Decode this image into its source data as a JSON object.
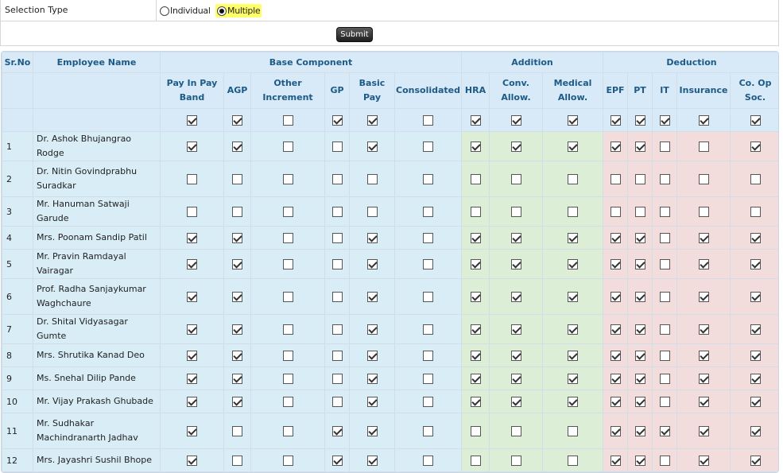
{
  "selection": {
    "label": "Selection Type",
    "options": [
      {
        "label": "Individual",
        "selected": false
      },
      {
        "label": "Multiple",
        "selected": true
      }
    ],
    "submit_label": "Submit"
  },
  "table": {
    "groups": {
      "srno": "Sr.No",
      "name": "Employee Name",
      "base": "Base Component",
      "addition": "Addition",
      "deduction": "Deduction"
    },
    "columns": [
      {
        "group": "base",
        "line1": "Pay In Pay",
        "line2": "Band"
      },
      {
        "group": "base",
        "line1": "AGP",
        "line2": ""
      },
      {
        "group": "base",
        "line1": "Other",
        "line2": "Increment"
      },
      {
        "group": "base",
        "line1": "GP",
        "line2": ""
      },
      {
        "group": "base",
        "line1": "Basic",
        "line2": "Pay"
      },
      {
        "group": "base",
        "line1": "Consolidated",
        "line2": ""
      },
      {
        "group": "addition",
        "line1": "HRA",
        "line2": ""
      },
      {
        "group": "addition",
        "line1": "Conv.",
        "line2": "Allow."
      },
      {
        "group": "addition",
        "line1": "Medical",
        "line2": "Allow."
      },
      {
        "group": "deduction",
        "line1": "EPF",
        "line2": ""
      },
      {
        "group": "deduction",
        "line1": "PT",
        "line2": ""
      },
      {
        "group": "deduction",
        "line1": "IT",
        "line2": ""
      },
      {
        "group": "deduction",
        "line1": "Insurance",
        "line2": ""
      },
      {
        "group": "deduction",
        "line1": "Co. Op",
        "line2": "Soc."
      }
    ],
    "select_all": [
      true,
      true,
      false,
      true,
      true,
      false,
      true,
      true,
      true,
      true,
      true,
      true,
      true,
      true
    ],
    "rows": [
      {
        "sr": "1",
        "name": "Dr. Ashok Bhujangrao Rodge",
        "checks": [
          true,
          true,
          false,
          false,
          true,
          false,
          true,
          true,
          true,
          true,
          true,
          false,
          false,
          true
        ]
      },
      {
        "sr": "2",
        "name": "Dr. Nitin Govindprabhu Suradkar",
        "checks": [
          false,
          false,
          false,
          false,
          false,
          false,
          false,
          false,
          false,
          false,
          false,
          false,
          false,
          false
        ]
      },
      {
        "sr": "3",
        "name": "Mr. Hanuman Satwaji Garude",
        "checks": [
          false,
          false,
          false,
          false,
          false,
          false,
          false,
          false,
          false,
          false,
          false,
          false,
          false,
          false
        ]
      },
      {
        "sr": "4",
        "name": "Mrs. Poonam Sandip Patil",
        "checks": [
          true,
          true,
          false,
          false,
          true,
          false,
          true,
          true,
          true,
          true,
          true,
          false,
          true,
          true
        ]
      },
      {
        "sr": "5",
        "name": "Mr. Pravin Ramdayal Vairagar",
        "checks": [
          true,
          true,
          false,
          false,
          true,
          false,
          true,
          true,
          true,
          true,
          true,
          false,
          true,
          true
        ]
      },
      {
        "sr": "6",
        "name": "Prof. Radha Sanjaykumar Waghchaure",
        "checks": [
          true,
          true,
          false,
          false,
          true,
          false,
          true,
          true,
          true,
          true,
          true,
          false,
          true,
          true
        ]
      },
      {
        "sr": "7",
        "name": "Dr. Shital Vidyasagar Gumte",
        "checks": [
          true,
          true,
          false,
          false,
          true,
          false,
          true,
          true,
          true,
          true,
          true,
          false,
          true,
          true
        ]
      },
      {
        "sr": "8",
        "name": "Mrs. Shrutika Kanad Deo",
        "checks": [
          true,
          true,
          false,
          false,
          true,
          false,
          true,
          true,
          true,
          true,
          true,
          false,
          true,
          true
        ]
      },
      {
        "sr": "9",
        "name": "Ms. Snehal Dilip Pande",
        "checks": [
          true,
          true,
          false,
          false,
          true,
          false,
          true,
          true,
          true,
          true,
          true,
          false,
          true,
          true
        ]
      },
      {
        "sr": "10",
        "name": "Mr. Vijay Prakash Ghubade",
        "checks": [
          true,
          true,
          false,
          false,
          true,
          false,
          true,
          true,
          true,
          true,
          true,
          false,
          true,
          true
        ]
      },
      {
        "sr": "11",
        "name": "Mr. Sudhakar Machindranarth Jadhav",
        "checks": [
          true,
          false,
          false,
          true,
          true,
          false,
          false,
          false,
          false,
          true,
          true,
          true,
          true,
          true
        ]
      },
      {
        "sr": "12",
        "name": "Mrs. Jayashri Sushil Bhope",
        "checks": [
          true,
          false,
          false,
          true,
          true,
          false,
          false,
          false,
          false,
          true,
          true,
          false,
          true,
          true
        ]
      }
    ]
  }
}
